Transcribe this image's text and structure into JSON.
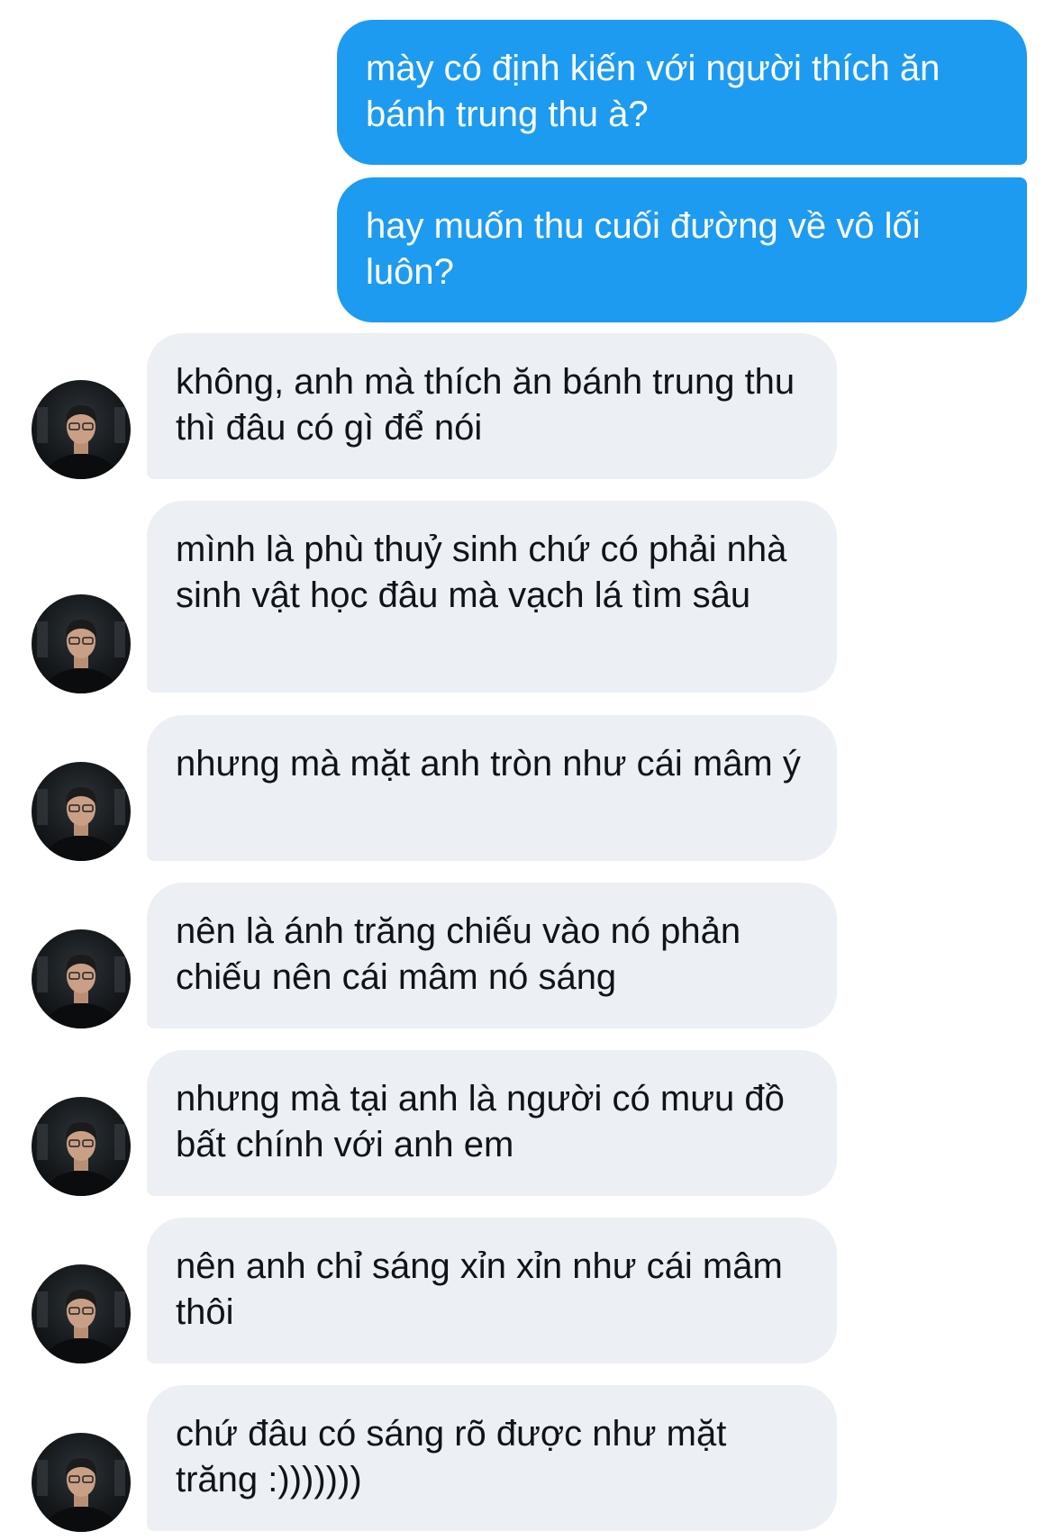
{
  "conversation": {
    "outgoing": [
      {
        "text": "mày có định kiến với người thích ăn bánh trung thu à?"
      },
      {
        "text": "hay muốn thu cuối đường về vô lối luôn?"
      }
    ],
    "incoming": [
      {
        "text": "không, anh mà thích ăn bánh trung thu thì đâu có gì để nói"
      },
      {
        "text": "mình là phù thuỷ sinh chứ có phải nhà sinh vật học đâu mà vạch lá tìm sâu"
      },
      {
        "text": "nhưng mà mặt anh tròn như cái mâm ý"
      },
      {
        "text": "nên là ánh trăng chiếu vào nó phản chiếu nên cái mâm nó sáng"
      },
      {
        "text": "nhưng mà tại anh là người có mưu đồ bất chính với anh em"
      },
      {
        "text": "nên anh chỉ sáng xỉn xỉn như cái mâm thôi"
      },
      {
        "text": "chứ đâu có sáng rõ được như mặt trăng :)))))))"
      }
    ],
    "colors": {
      "outgoing_bubble": "#1d9bf0",
      "outgoing_text": "#ffffff",
      "incoming_bubble": "#eceff3",
      "incoming_text": "#0f1419",
      "background": "#ffffff"
    },
    "icons": {
      "sender_avatar": "avatar-photo-icon"
    }
  }
}
